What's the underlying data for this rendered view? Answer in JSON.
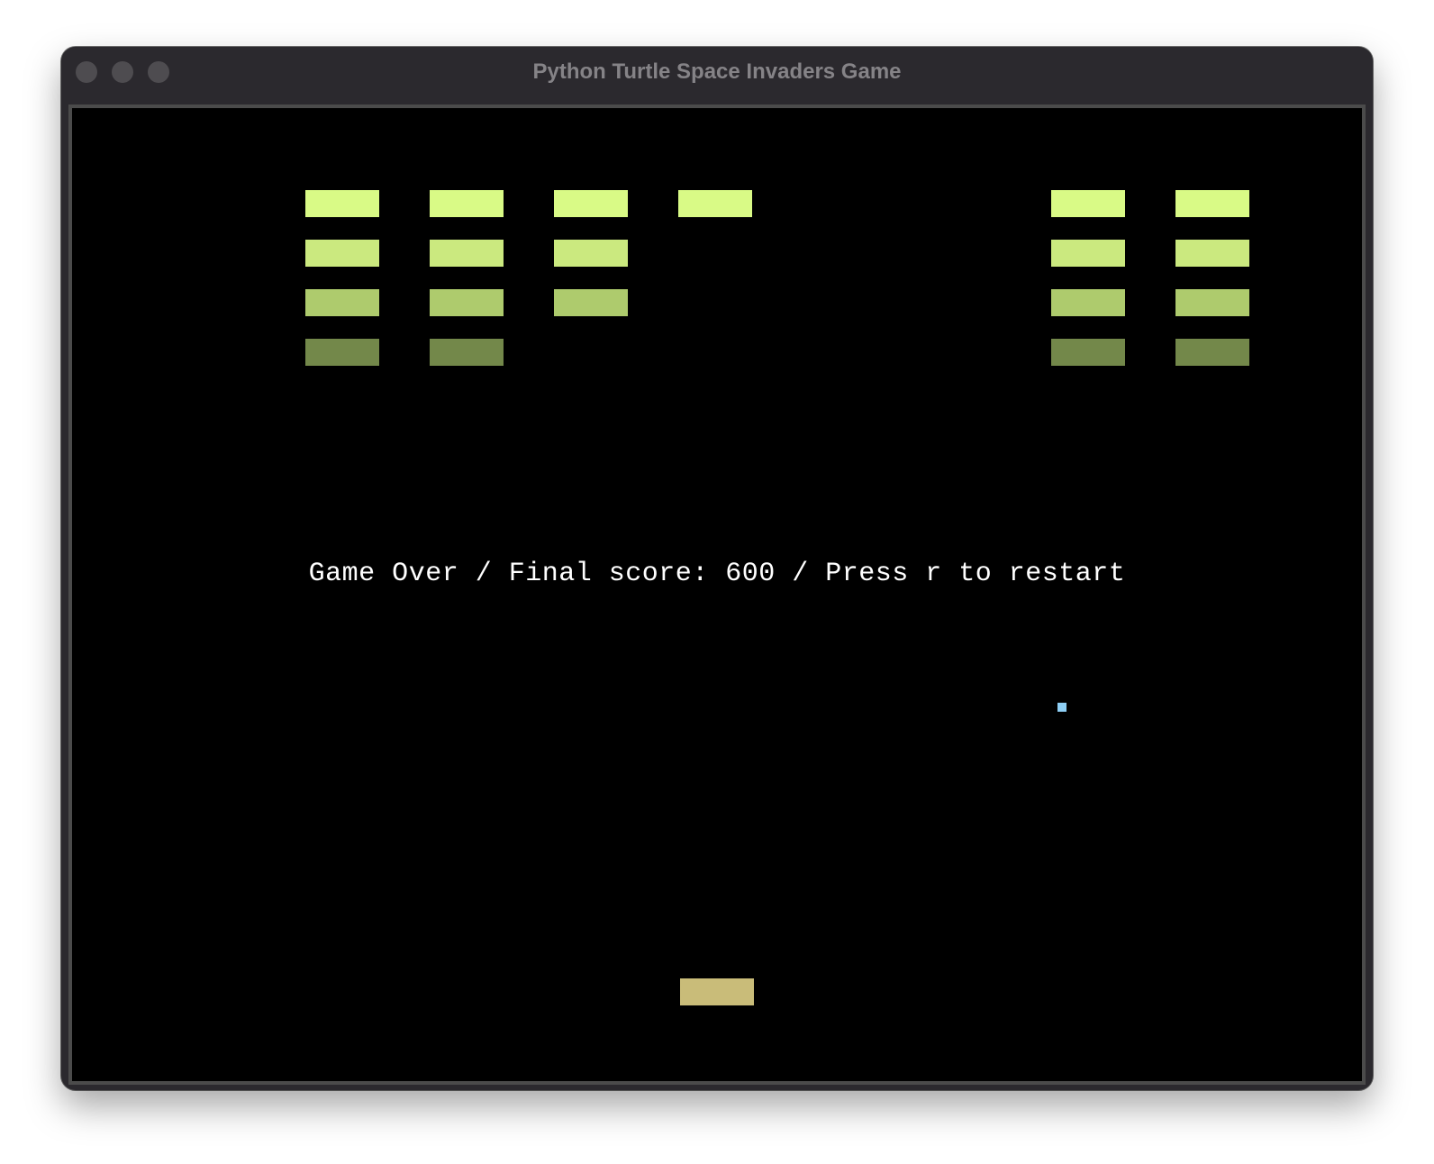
{
  "window": {
    "title": "Python Turtle Space Invaders Game"
  },
  "colors": {
    "row1": "#d9fa86",
    "row2": "#cbe97f",
    "row3": "#aecb6d",
    "row4": "#73884a",
    "player": "#c9bc79",
    "bullet": "#8ecff5",
    "background": "#000000"
  },
  "game": {
    "status_text": "Game Over / Final score: 600 / Press r to restart",
    "final_score": 600,
    "invader_grid": [
      [
        1,
        1,
        1,
        1,
        0,
        0,
        1,
        1
      ],
      [
        1,
        1,
        1,
        0,
        0,
        0,
        1,
        1
      ],
      [
        1,
        1,
        1,
        0,
        0,
        0,
        1,
        1
      ],
      [
        1,
        1,
        0,
        0,
        0,
        0,
        1,
        1
      ]
    ]
  }
}
